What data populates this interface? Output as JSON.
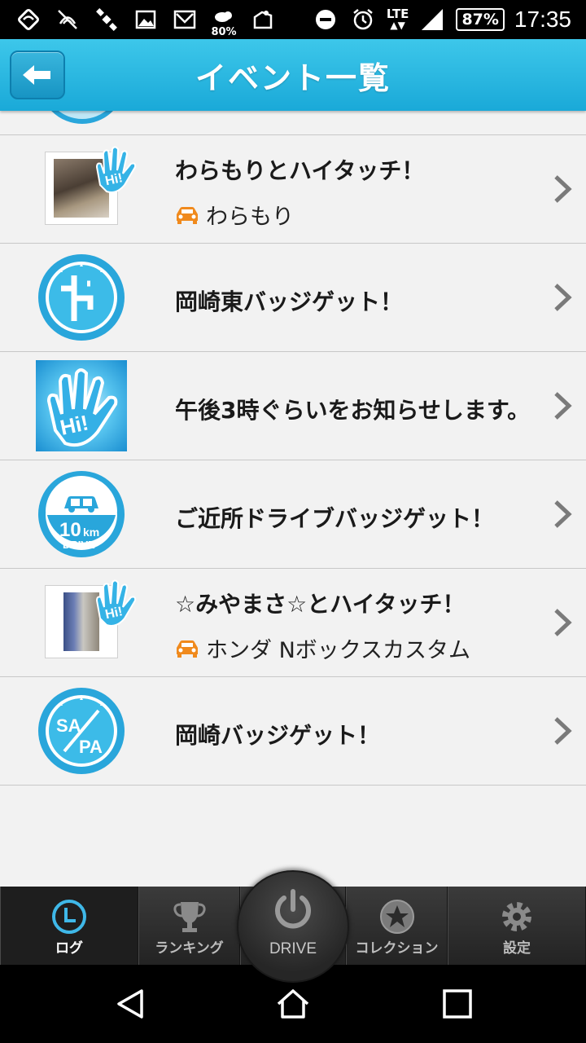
{
  "status_bar": {
    "weather_percent": "80%",
    "network": "LTE",
    "battery": "87%",
    "time": "17:35"
  },
  "header": {
    "title": "イベント一覧"
  },
  "events": [
    {
      "title": "わらもりとハイタッチ！",
      "subtitle": "わらもり",
      "thumb": "photo-hi"
    },
    {
      "title": "岡崎東バッジゲット！",
      "subtitle": "",
      "thumb": "interchange-badge"
    },
    {
      "title": "午後3時ぐらいをお知らせします。",
      "subtitle": "",
      "thumb": "hi-hand"
    },
    {
      "title": "ご近所ドライブバッジゲット！",
      "subtitle": "",
      "thumb": "10km-drive-badge",
      "badge_text": "10",
      "badge_unit": "km",
      "badge_label": "DRIVE"
    },
    {
      "title": "☆みやまさ☆とハイタッチ！",
      "subtitle": "ホンダ Nボックスカスタム",
      "thumb": "photo-hi"
    },
    {
      "title": "岡崎バッジゲット！",
      "subtitle": "",
      "thumb": "sapa-badge",
      "badge_text_top": "SA",
      "badge_text_bottom": "PA"
    }
  ],
  "hi_text": "Hi!",
  "tabbar": {
    "tabs": [
      {
        "label": "ログ",
        "active": true
      },
      {
        "label": "ランキング",
        "active": false
      },
      {
        "label": "DRIVE",
        "active": false
      },
      {
        "label": "コレクション",
        "active": false
      },
      {
        "label": "設定",
        "active": false
      }
    ]
  },
  "colors": {
    "header": "#1aa9d8",
    "accent_blue": "#29a6db",
    "car_orange": "#f08a1d",
    "tab_active_icon": "#3fb8e8"
  }
}
